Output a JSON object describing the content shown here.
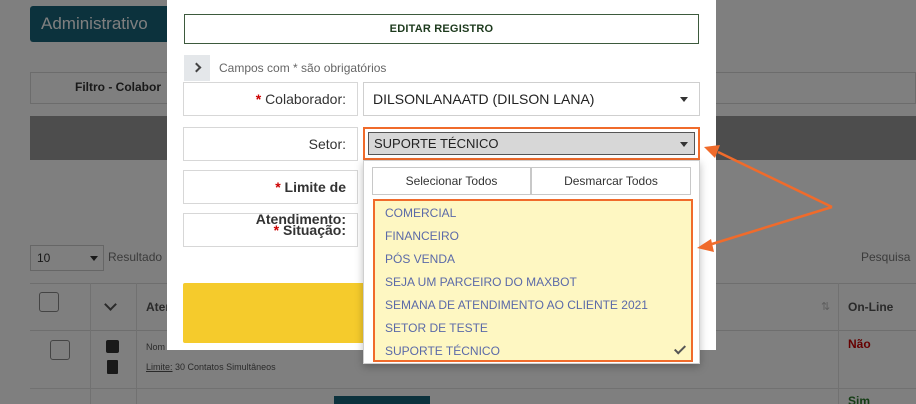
{
  "background": {
    "title": "Administrativo",
    "filter_label": "Filtro - Colabor",
    "page_size": "10",
    "results_label": "Resultado",
    "search_label": "Pesquisa",
    "col_atendente": "Aten",
    "col_online": "On-Line",
    "row1_name": "Nom",
    "row1_limit_label": "Limite:",
    "row1_limit_value": "30 Contatos Simultâneos",
    "row1_online": "Não",
    "row2_online": "Sim"
  },
  "modal": {
    "title": "EDITAR REGISTRO",
    "required_note": "Campos com * são obrigatórios",
    "fields": {
      "colaborador": {
        "label": "Colaborador:",
        "value": "DILSONLANAATD (DILSON LANA)",
        "required": "*"
      },
      "setor": {
        "label": "Setor:",
        "value": "SUPORTE TÉCNICO"
      },
      "limite": {
        "label": "Limite de Atendimento:",
        "required": "*"
      },
      "situacao": {
        "label": "Situação:",
        "required": "*"
      }
    }
  },
  "dropdown": {
    "select_all": "Selecionar Todos",
    "deselect_all": "Desmarcar Todos",
    "options": [
      "COMERCIAL",
      "FINANCEIRO",
      "PÓS VENDA",
      "SEJA UM PARCEIRO DO MAXBOT",
      "SEMANA DE ATENDIMENTO AO CLIENTE 2021",
      "SETOR DE TESTE",
      "SUPORTE TÉCNICO"
    ],
    "selected": "SUPORTE TÉCNICO"
  },
  "colors": {
    "annotation": "#f06b2b",
    "option_highlight": "#fef7c2",
    "primary": "#19647a",
    "accent_button": "#f5cb2c"
  }
}
